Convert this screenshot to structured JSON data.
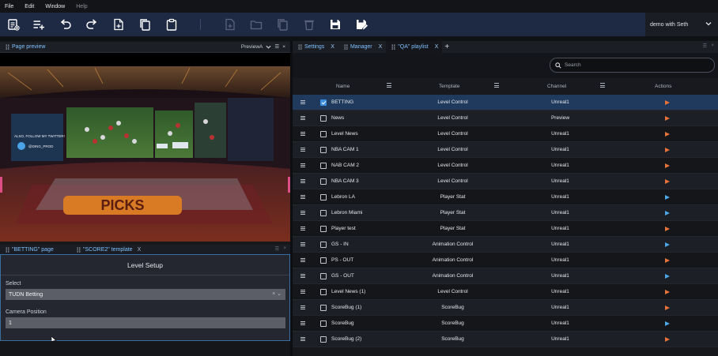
{
  "menu": [
    "File",
    "Edit",
    "Window",
    "Help"
  ],
  "user": {
    "label": "demo with Seth"
  },
  "left_top": {
    "title": "Page preview",
    "preview_selector": "PreviewA"
  },
  "left_bottom": {
    "tabs": [
      {
        "label": "\"BETTING\" page"
      },
      {
        "label": "\"SCORE2\" template"
      }
    ],
    "panel_title": "Level Setup",
    "select_label": "Select",
    "select_value": "TUDN Betting",
    "camera_label": "Camera Position",
    "camera_value": "1"
  },
  "right": {
    "tabs": [
      {
        "label": "Settings"
      },
      {
        "label": "Manager"
      },
      {
        "label": "\"QA\" playlist"
      }
    ],
    "search_placeholder": "Search",
    "columns": [
      "Name",
      "Template",
      "Channel",
      "Actions"
    ],
    "rows": [
      {
        "name": "BETTING",
        "template": "Level Control",
        "channel": "Unreal1",
        "checked": true,
        "play": "orange"
      },
      {
        "name": "News",
        "template": "Level Control",
        "channel": "Preview",
        "checked": false,
        "play": "orange"
      },
      {
        "name": "Level News",
        "template": "Level Control",
        "channel": "Unreal1",
        "checked": false,
        "play": "orange"
      },
      {
        "name": "NBA CAM 1",
        "template": "Level Control",
        "channel": "Unreal1",
        "checked": false,
        "play": "orange"
      },
      {
        "name": "NAB CAM 2",
        "template": "Level Control",
        "channel": "Unreal1",
        "checked": false,
        "play": "orange"
      },
      {
        "name": "NBA CAM 3",
        "template": "Level Control",
        "channel": "Unreal1",
        "checked": false,
        "play": "orange"
      },
      {
        "name": "Lebron LA",
        "template": "Player Stat",
        "channel": "Unreal1",
        "checked": false,
        "play": "blue"
      },
      {
        "name": "Lebron Miami",
        "template": "Player Stat",
        "channel": "Unreal1",
        "checked": false,
        "play": "blue"
      },
      {
        "name": "Player test",
        "template": "Player Stat",
        "channel": "Unreal1",
        "checked": false,
        "play": "orange"
      },
      {
        "name": "GS - IN",
        "template": "Animation Control",
        "channel": "Unreal1",
        "checked": false,
        "play": "blue"
      },
      {
        "name": "PS - OUT",
        "template": "Animation Control",
        "channel": "Unreal1",
        "checked": false,
        "play": "orange"
      },
      {
        "name": "GS - OUT",
        "template": "Animation Control",
        "channel": "Unreal1",
        "checked": false,
        "play": "blue"
      },
      {
        "name": "Level News (1)",
        "template": "Level Control",
        "channel": "Unreal1",
        "checked": false,
        "play": "orange"
      },
      {
        "name": "ScoreBug (1)",
        "template": "ScoreBug",
        "channel": "Unreal1",
        "checked": false,
        "play": "orange"
      },
      {
        "name": "ScoreBug",
        "template": "ScoreBug",
        "channel": "Unreal1",
        "checked": false,
        "play": "blue"
      },
      {
        "name": "ScoreBug (2)",
        "template": "ScoreBug",
        "channel": "Unreal1",
        "checked": false,
        "play": "orange"
      }
    ]
  },
  "preview_image": {
    "twitter_line1": "ALSO, FOLLOW MY TWITTER!",
    "twitter_handle": "@DING_PROD",
    "floor_logo": "PICKS"
  },
  "colors": {
    "toolbar": "#1e2944",
    "accent": "#7fc0ff",
    "play_orange": "#e8733a",
    "play_blue": "#4fa7e8",
    "selected_row": "#1f3a5c"
  }
}
